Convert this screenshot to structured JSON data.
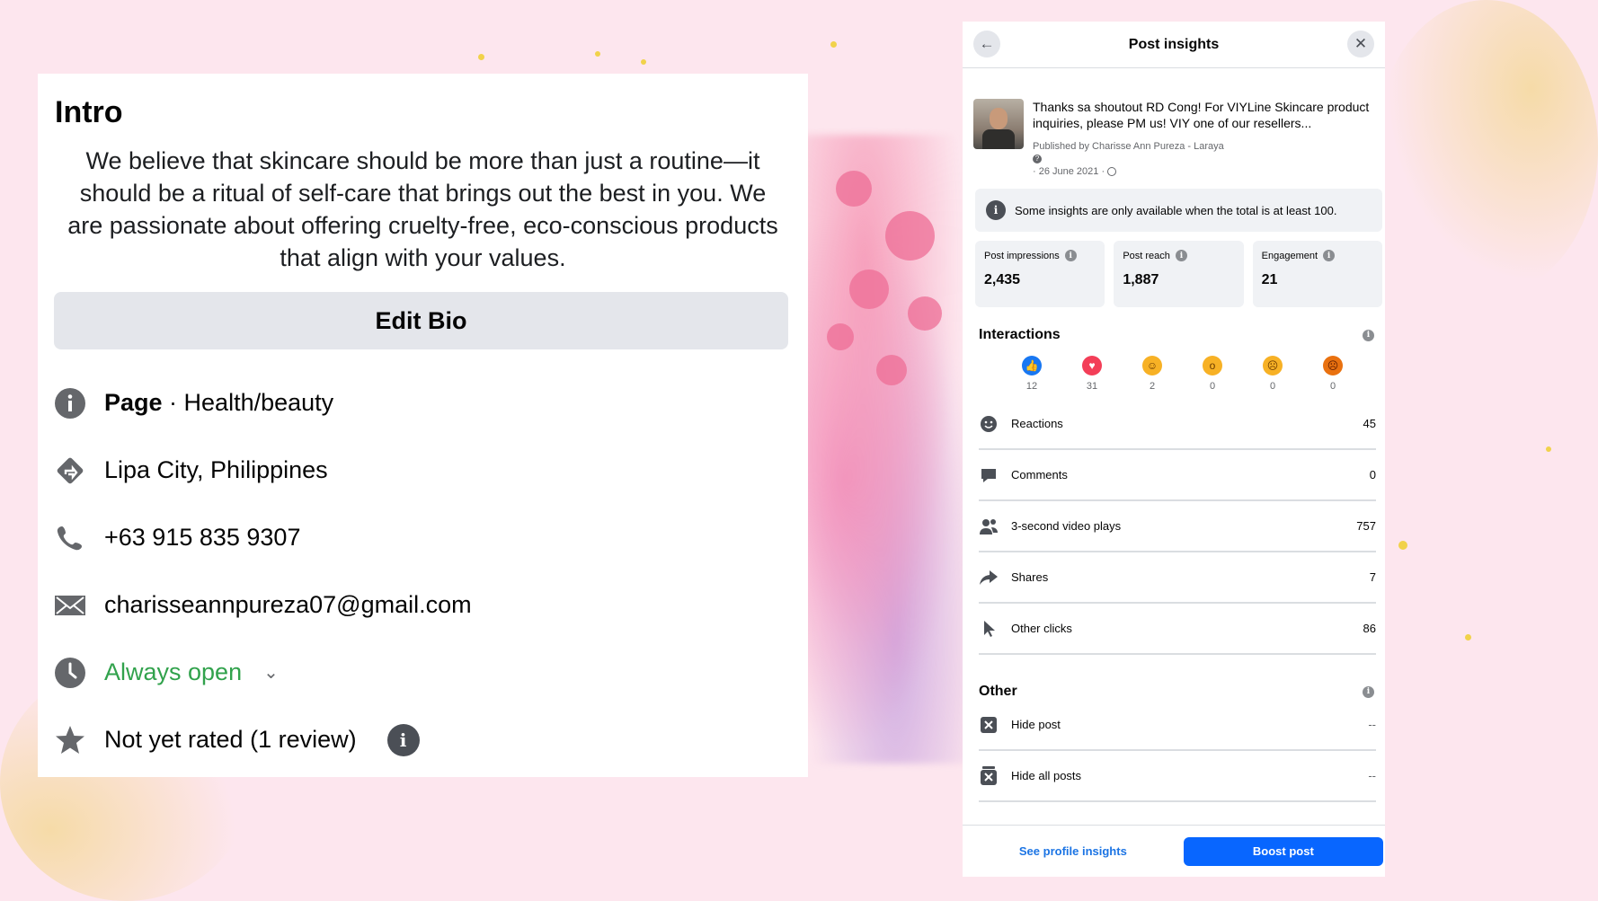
{
  "intro": {
    "title": "Intro",
    "bio": "We believe that skincare should be more than just a routine—it should be a ritual of self-care that brings out the best in you. We are passionate about offering cruelty-free, eco-conscious products that align with your values.",
    "edit_bio_label": "Edit Bio",
    "page_label": "Page",
    "page_separator": " · ",
    "category": "Health/beauty",
    "location": "Lipa City, Philippines",
    "phone": "+63 915 835 9307",
    "email": "charisseannpureza07@gmail.com",
    "hours": "Always open",
    "rating": "Not yet rated (1 review)"
  },
  "insights": {
    "title": "Post insights",
    "post_text": "Thanks sa shoutout RD Cong! For VIYLine Skincare product inquiries, please PM us! VIY one of our resellers...",
    "published_by": "Published by Charisse Ann Pureza - Laraya",
    "date": "· 26 June 2021 ·",
    "notice": "Some insights are only available when the total is at least 100.",
    "metrics": [
      {
        "label": "Post impressions",
        "value": "2,435"
      },
      {
        "label": "Post reach",
        "value": "1,887"
      },
      {
        "label": "Engagement",
        "value": "21"
      }
    ],
    "interactions_title": "Interactions",
    "reactions": [
      {
        "name": "like",
        "count": "12",
        "color": "#1877f2"
      },
      {
        "name": "love",
        "count": "31",
        "color": "#f33e58"
      },
      {
        "name": "haha",
        "count": "2",
        "color": "#f7b125"
      },
      {
        "name": "wow",
        "count": "0",
        "color": "#f7b125"
      },
      {
        "name": "sad",
        "count": "0",
        "color": "#f7b125"
      },
      {
        "name": "angry",
        "count": "0",
        "color": "#e9710f"
      }
    ],
    "interaction_rows": [
      {
        "label": "Reactions",
        "value": "45"
      },
      {
        "label": "Comments",
        "value": "0"
      },
      {
        "label": "3-second video plays",
        "value": "757"
      },
      {
        "label": "Shares",
        "value": "7"
      },
      {
        "label": "Other clicks",
        "value": "86"
      }
    ],
    "other_title": "Other",
    "other_rows": [
      {
        "label": "Hide post",
        "value": "--"
      },
      {
        "label": "Hide all posts",
        "value": "--"
      }
    ],
    "footer": {
      "profile_insights": "See profile insights",
      "boost": "Boost post"
    }
  },
  "colors": {
    "background": "#fde6ee",
    "accent_blue": "#0866ff",
    "open_green": "#31a24c"
  }
}
